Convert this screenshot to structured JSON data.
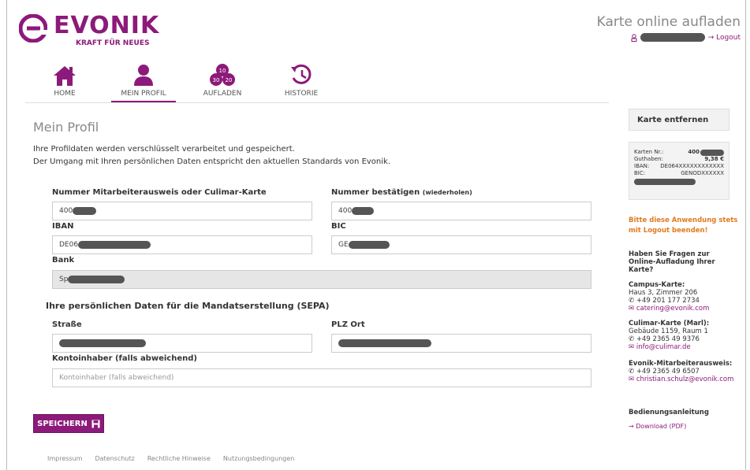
{
  "brand": {
    "name": "EVONIK",
    "tagline": "KRAFT FÜR NEUES",
    "color": "#8c1a7a"
  },
  "header": {
    "title": "Karte online aufladen",
    "logout": "→ Logout"
  },
  "nav": {
    "home": "HOME",
    "profile": "MEIN PROFIL",
    "topup": "AUFLADEN",
    "history": "HISTORIE",
    "topup_badges": [
      "10",
      "30",
      "20"
    ]
  },
  "main": {
    "title": "Mein Profil",
    "intro_line1": "Ihre Profildaten werden verschlüsselt verarbeitet und gespeichert.",
    "intro_line2": "Der Umgang mit Ihren persönlichen Daten entspricht den aktuellen Standards von Evonik.",
    "fields": {
      "card_number_label": "Nummer Mitarbeiterausweis oder Culimar-Karte",
      "card_number_value": "400",
      "confirm_label": "Nummer bestätigen",
      "confirm_hint": "(wiederholen)",
      "confirm_value": "400",
      "iban_label": "IBAN",
      "iban_value": "DE06",
      "bic_label": "BIC",
      "bic_value": "GE",
      "bank_label": "Bank",
      "bank_value": "Sp"
    },
    "sepa_title": "Ihre persönlichen Daten für die Mandatserstellung (SEPA)",
    "address": {
      "street_label": "Straße",
      "zip_city_label": "PLZ Ort",
      "holder_label": "Kontoinhaber (falls abweichend)",
      "holder_placeholder": "Kontoinhaber (falls abweichend)"
    },
    "save_label": "SPEICHERN"
  },
  "footer": [
    "Impressum",
    "Datenschutz",
    "Rechtliche Hinweise",
    "Nutzungsbedingungen"
  ],
  "sidebar": {
    "remove_card": "Karte entfernen",
    "card": {
      "nr_label": "Karten Nr.:",
      "nr_value": "400",
      "balance_label": "Guthaben:",
      "balance_value": "9,38 €",
      "iban_label": "IBAN:",
      "iban_value": "DE064XXXXXXXXXXXX",
      "bic_label": "BIC:",
      "bic_value": "GENODXXXXXX"
    },
    "warning_line1": "Bitte diese Anwendung stets",
    "warning_line2": "mit Logout beenden!",
    "questions": "Haben Sie Fragen zur Online-Aufladung Ihrer Karte?",
    "campus_title": "Campus-Karte:",
    "campus_line1": "Haus 3, Zimmer 206",
    "campus_phone": "+49 201 177 2734",
    "campus_email": "catering@evonik.com",
    "culimar_title": "Culimar-Karte (Marl):",
    "culimar_line1": "Gebäude 1159, Raum 1",
    "culimar_phone": "+49 2365 49 9376",
    "culimar_email": "info@culimar.de",
    "employee_title": "Evonik-Mitarbeiterausweis:",
    "employee_phone": "+49 2365 49 6507",
    "employee_email": "christian.schulz@evonik.com",
    "manual_title": "Bedienungsanleitung",
    "manual_link": "→ Download (PDF)"
  }
}
